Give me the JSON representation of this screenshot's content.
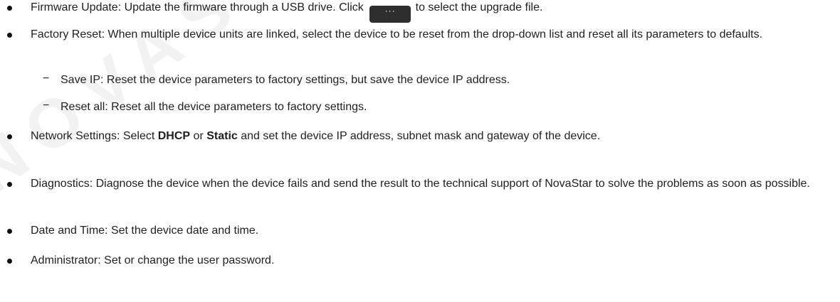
{
  "watermark": "NOVASTAR",
  "items": [
    {
      "label": "Firmware Update:",
      "text_before": " Update the firmware through a USB drive. Click ",
      "button_label": "···",
      "text_after": " to select the upgrade file."
    },
    {
      "label": "Factory Reset:",
      "text": " When multiple device units are linked, select the device to be reset from the drop-down list and reset all its parameters to defaults.",
      "sub": [
        {
          "dash": "−",
          "label": "Save IP:",
          "text": " Reset the device parameters to factory settings, but save the device IP address."
        },
        {
          "dash": "−",
          "label": "Reset all:",
          "text": " Reset all the device parameters to factory settings."
        }
      ]
    },
    {
      "label": "Network Settings:",
      "text_a": " Select ",
      "bold_a": "DHCP",
      "text_b": " or ",
      "bold_b": "Static",
      "text_c": " and set the device IP address, subnet mask and gateway of the device."
    },
    {
      "label": "Diagnostics:",
      "text": " Diagnose the device when the device fails and send the result to the technical support of NovaStar to solve the problems as soon as possible."
    },
    {
      "label": "Date and Time:",
      "text": " Set the device date and time."
    },
    {
      "label": "Administrator:",
      "text": " Set or change the user password."
    }
  ]
}
